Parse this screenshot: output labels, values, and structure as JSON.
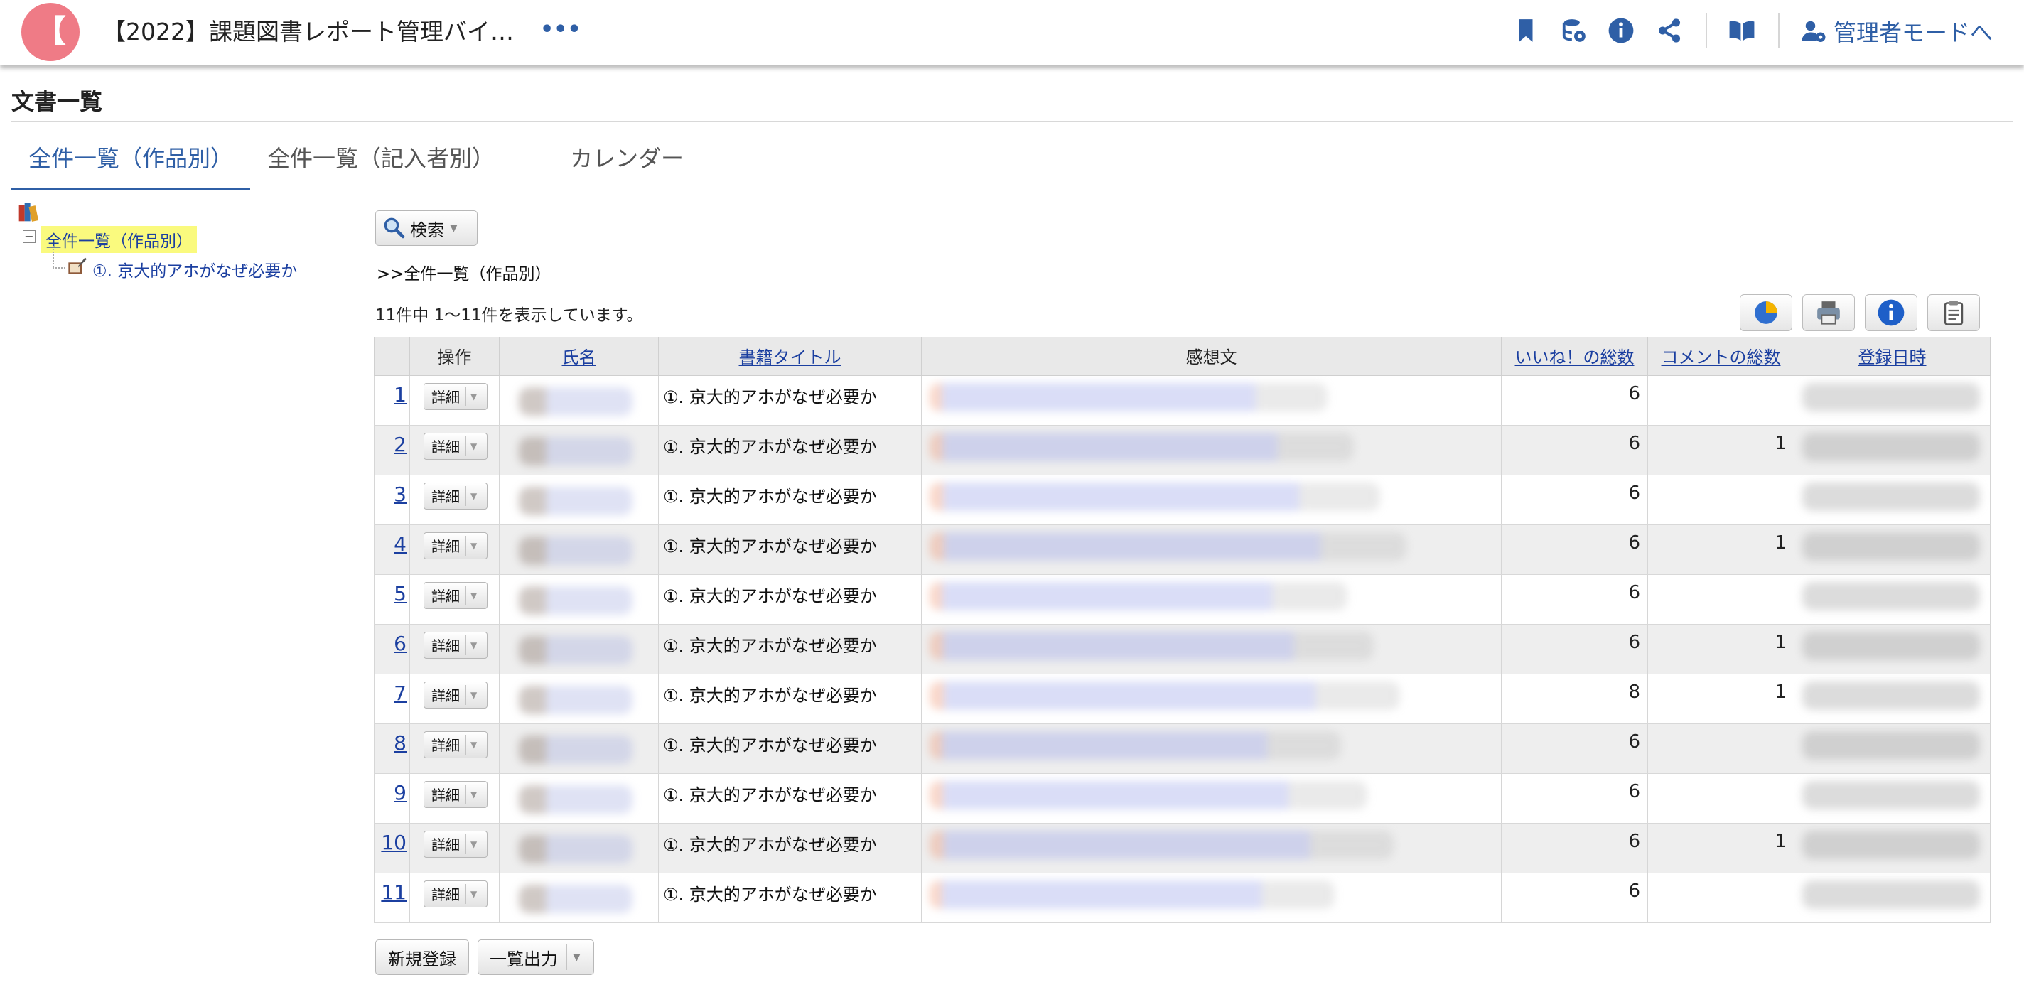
{
  "header": {
    "logo_char": "【",
    "title": "【2022】課題図書レポート管理バイ…",
    "more": "•••",
    "admin_label": "管理者モードへ",
    "icons": [
      "bookmark-icon",
      "db-settings-icon",
      "info-icon",
      "share-icon",
      "book-open-icon",
      "user-gear-icon"
    ],
    "accent": "#2f5fa6",
    "logo_color": "#ef7b86"
  },
  "page": {
    "title": "文書一覧"
  },
  "tabs": [
    {
      "label": "全件一覧（作品別）",
      "active": true
    },
    {
      "label": "全件一覧（記入者別）",
      "active": false
    },
    {
      "label": "カレンダー",
      "active": false
    }
  ],
  "tree": {
    "toggle": "−",
    "root_label": "全件一覧（作品別）",
    "child_label": "①. 京大的アホがなぜ必要か",
    "highlight": "#fafa7e"
  },
  "search": {
    "label": "検索"
  },
  "breadcrumb": ">>全件一覧（作品別）",
  "result_count": "11件中 1〜11件を表示しています。",
  "toolbar_icons": [
    "pie-chart-icon",
    "print-icon",
    "info-icon",
    "clipboard-icon"
  ],
  "table": {
    "headers": {
      "op": "操作",
      "name": "氏名",
      "book": "書籍タイトル",
      "review": "感想文",
      "likes": "いいね！の総数",
      "comments": "コメントの総数",
      "date": "登録日時"
    },
    "detail_label": "詳細",
    "rows": [
      {
        "no": "1",
        "book": "①. 京大的アホがなぜ必要か",
        "likes": "6",
        "comments": ""
      },
      {
        "no": "2",
        "book": "①. 京大的アホがなぜ必要か",
        "likes": "6",
        "comments": "1"
      },
      {
        "no": "3",
        "book": "①. 京大的アホがなぜ必要か",
        "likes": "6",
        "comments": ""
      },
      {
        "no": "4",
        "book": "①. 京大的アホがなぜ必要か",
        "likes": "6",
        "comments": "1"
      },
      {
        "no": "5",
        "book": "①. 京大的アホがなぜ必要か",
        "likes": "6",
        "comments": ""
      },
      {
        "no": "6",
        "book": "①. 京大的アホがなぜ必要か",
        "likes": "6",
        "comments": "1"
      },
      {
        "no": "7",
        "book": "①. 京大的アホがなぜ必要か",
        "likes": "8",
        "comments": "1"
      },
      {
        "no": "8",
        "book": "①. 京大的アホがなぜ必要か",
        "likes": "6",
        "comments": ""
      },
      {
        "no": "9",
        "book": "①. 京大的アホがなぜ必要か",
        "likes": "6",
        "comments": ""
      },
      {
        "no": "10",
        "book": "①. 京大的アホがなぜ必要か",
        "likes": "6",
        "comments": "1"
      },
      {
        "no": "11",
        "book": "①. 京大的アホがなぜ必要か",
        "likes": "6",
        "comments": ""
      }
    ]
  },
  "footer_buttons": {
    "new": "新規登録",
    "export": "一覧出力"
  }
}
